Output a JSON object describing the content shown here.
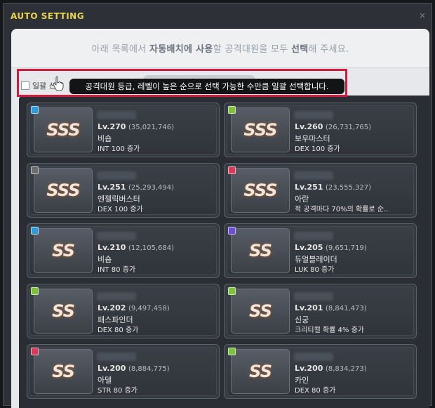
{
  "window": {
    "title": "AUTO SETTING",
    "close_label": "×"
  },
  "instruction": {
    "part1": "아래 목록에서 ",
    "bold1": "자동배치에 사용",
    "part2": "할 공격대원을 모두 ",
    "bold2": "선택",
    "part3": "해 주세요."
  },
  "select_all": {
    "label": "일괄 선택",
    "checked": false
  },
  "tooltip": "공격대원 등급, 레벨이 높은 순으로 선택 가능한 수만큼 일괄 선택합니다.",
  "cards": [
    {
      "icon": "mage-class-icon",
      "grade": "SSS",
      "level": "Lv.270",
      "exp": "(35,021,746)",
      "class": "비숍",
      "effect": "INT 100 증가"
    },
    {
      "icon": "thief-class-icon",
      "grade": "SSS",
      "level": "Lv.260",
      "exp": "(26,731,765)",
      "class": "보우마스터",
      "effect": "DEX 100 증가"
    },
    {
      "icon": "pirate-class-icon",
      "grade": "SSS",
      "level": "Lv.251",
      "exp": "(25,293,494)",
      "class": "엔젤릭버스터",
      "effect": "DEX 100 증가"
    },
    {
      "icon": "warrior-class-icon",
      "grade": "SSS",
      "level": "Lv.251",
      "exp": "(23,555,327)",
      "class": "아란",
      "effect": "적 공격마다 70%의 확률로 순.."
    },
    {
      "icon": "mage-class-icon",
      "grade": "SS",
      "level": "Lv.210",
      "exp": "(12,105,684)",
      "class": "비숍",
      "effect": "INT 80 증가"
    },
    {
      "icon": "xenon-class-icon",
      "grade": "SS",
      "level": "Lv.205",
      "exp": "(9,651,719)",
      "class": "듀얼블레이더",
      "effect": "LUK 80 증가"
    },
    {
      "icon": "thief-class-icon",
      "grade": "SS",
      "level": "Lv.202",
      "exp": "(9,497,458)",
      "class": "패스파인더",
      "effect": "DEX 80 증가"
    },
    {
      "icon": "thief-class-icon",
      "grade": "SS",
      "level": "Lv.201",
      "exp": "(8,841,473)",
      "class": "신궁",
      "effect": "크리티컬 확률 4% 증가"
    },
    {
      "icon": "warrior-class-icon",
      "grade": "SS",
      "level": "Lv.200",
      "exp": "(8,884,775)",
      "class": "아델",
      "effect": "STR 80 증가"
    },
    {
      "icon": "thief-class-icon",
      "grade": "SS",
      "level": "Lv.200",
      "exp": "(8,834,273)",
      "class": "카인",
      "effect": "DEX 80 증가"
    }
  ],
  "colors": {
    "title": "#e8d44a",
    "highlight": "#d21a3c",
    "grade_glow": "#9b5f3a"
  }
}
